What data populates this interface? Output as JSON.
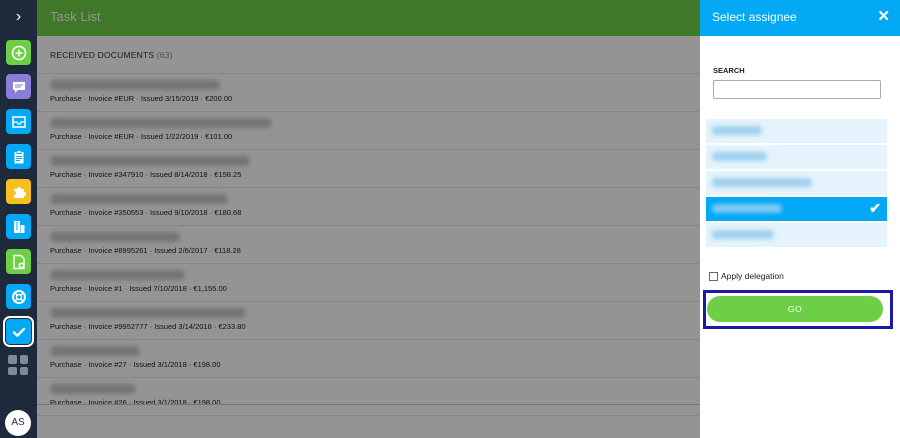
{
  "rail": {
    "expand_glyph": "›",
    "apps": [
      {
        "icon": "plus-circle-icon",
        "color": "#6ccf45"
      },
      {
        "icon": "chat-icon",
        "color": "#8a7fd6"
      },
      {
        "icon": "inbox-icon",
        "color": "#03a9f4"
      },
      {
        "icon": "clipboard-icon",
        "color": "#03a9f4"
      },
      {
        "icon": "puzzle-icon",
        "color": "#f7c020"
      },
      {
        "icon": "building-icon",
        "color": "#03a9f4"
      },
      {
        "icon": "document-add-icon",
        "color": "#6ccf45"
      },
      {
        "icon": "lifebuoy-icon",
        "color": "#03a9f4"
      },
      {
        "icon": "checkmark-icon",
        "color": "#03a9f4"
      }
    ],
    "avatar": "AS"
  },
  "main": {
    "title": "Task List",
    "section_label": "RECEIVED DOCUMENTS",
    "section_count": "(63)",
    "rows": [
      {
        "sub": "Purchase · Invoice #EUR · Issued 3/15/2019 · €200.00"
      },
      {
        "sub": "Purchase · Invoice #EUR · Issued 1/22/2019 · €101.00"
      },
      {
        "sub": "Purchase · Invoice #347910 · Issued 8/14/2018 · €158.25"
      },
      {
        "sub": "Purchase · Invoice #350553 · Issued 9/10/2018 · €180.68"
      },
      {
        "sub": "Purchase · Invoice #8995261 · Issued 2/6/2017 · €118.28"
      },
      {
        "sub": "Purchase · Invoice #1 · Issued 7/10/2018 · €1,155.00"
      },
      {
        "sub": "Purchase · Invoice #9952777 · Issued 3/14/2018 · €233.80"
      },
      {
        "sub": "Purchase · Invoice #27 · Issued 3/1/2018 · €198.00"
      },
      {
        "sub": "Purchase · Invoice #26 · Issued 3/1/2018 · €198.00"
      }
    ]
  },
  "panel": {
    "title": "Select assignee",
    "close_glyph": "✕",
    "search_label": "SEARCH",
    "search_value": "",
    "selected_index": 3,
    "delegation_label": "Apply delegation",
    "delegation_checked": false,
    "go_label": "GO"
  },
  "colors": {
    "green": "#6ccf45",
    "blue": "#03a9f4",
    "rail": "#1e2a3b",
    "highlight_frame": "#1a1aa6"
  }
}
